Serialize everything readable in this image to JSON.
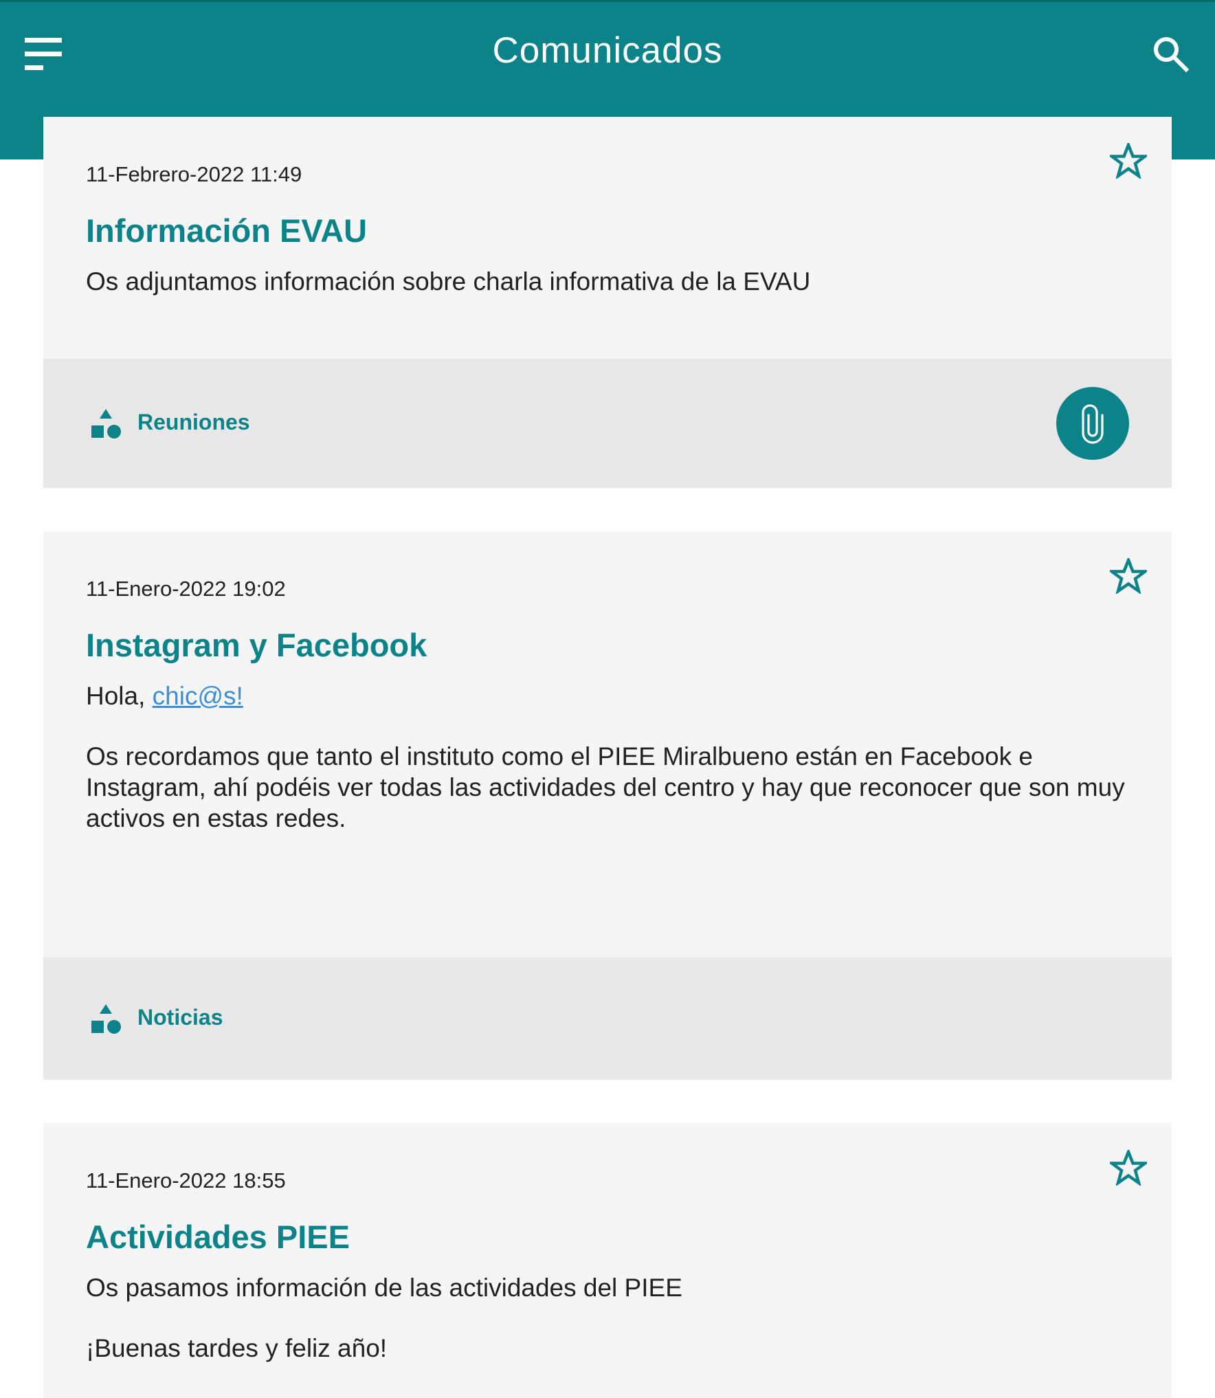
{
  "app": {
    "title": "Comunicados",
    "menu_icon": "menu-icon",
    "search_icon": "search-icon"
  },
  "colors": {
    "primary": "#0b8389",
    "card_bg": "#f5f5f5",
    "footer_bg": "#e8e8e8",
    "link": "#3c8fd4",
    "text": "#222222"
  },
  "messages": [
    {
      "date": "11-Febrero-2022 11:49",
      "title": "Información EVAU",
      "body": [
        "Os adjuntamos información sobre charla informativa de la EVAU"
      ],
      "category": "Reuniones",
      "category_icon": "shapes-icon",
      "favorite_icon": "star-outline-icon",
      "has_attachment": true,
      "attachment_icon": "paperclip-icon"
    },
    {
      "date": "11-Enero-2022 19:02",
      "title": "Instagram y Facebook",
      "greeting": "Hola, ",
      "greeting_link": "chic@s!",
      "body": [
        "Os recordamos que tanto el instituto como el PIEE Miralbueno están en Facebook e Instagram, ahí podéis ver todas las actividades del centro y hay que reconocer que son muy activos en estas redes."
      ],
      "category": "Noticias",
      "category_icon": "shapes-icon",
      "favorite_icon": "star-outline-icon",
      "has_attachment": false
    },
    {
      "date": "11-Enero-2022 18:55",
      "title": "Actividades PIEE",
      "body": [
        "Os pasamos información de las actividades del PIEE",
        "¡Buenas tardes y feliz año!"
      ],
      "favorite_icon": "star-outline-icon"
    }
  ]
}
